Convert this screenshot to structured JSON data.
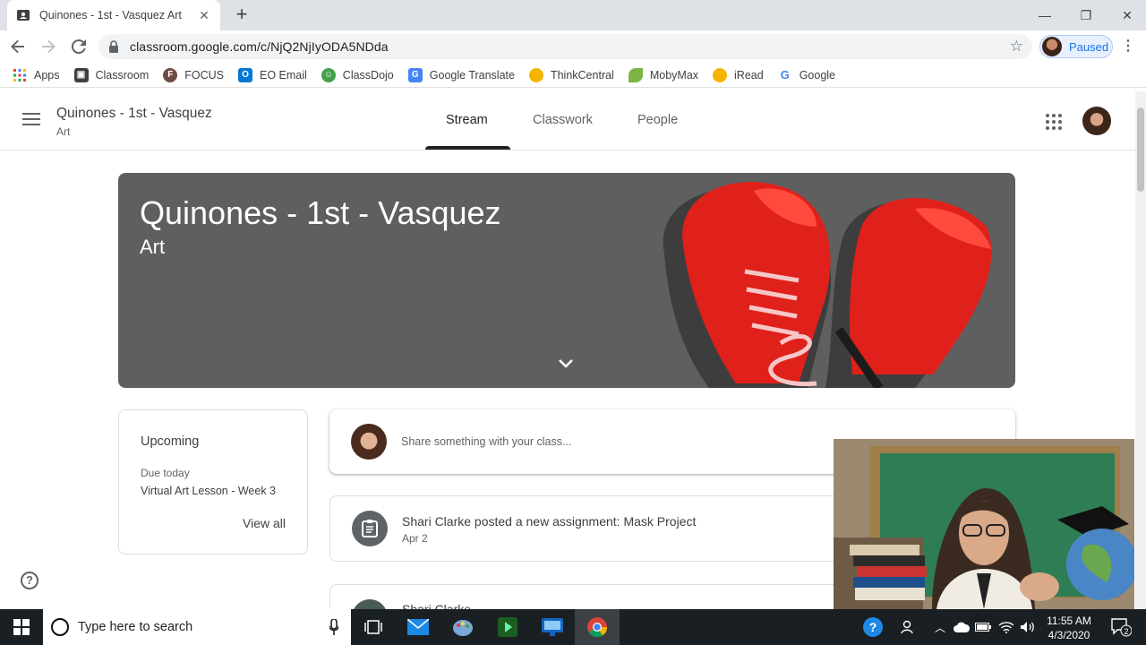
{
  "browser": {
    "tab_title": "Quinones - 1st - Vasquez Art",
    "new_tab": "+",
    "url": "classroom.google.com/c/NjQ2NjIyODA5NDda",
    "profile_status": "Paused"
  },
  "bookmarks": [
    {
      "label": "Apps",
      "icon": "apps-grid-icon",
      "color": "#4285f4"
    },
    {
      "label": "Classroom",
      "icon": "classroom-icon",
      "color": "#3c4043"
    },
    {
      "label": "FOCUS",
      "icon": "focus-icon",
      "color": "#6d4c41"
    },
    {
      "label": "EO Email",
      "icon": "outlook-icon",
      "color": "#0078d4"
    },
    {
      "label": "ClassDojo",
      "icon": "classdojo-icon",
      "color": "#43a047"
    },
    {
      "label": "Google Translate",
      "icon": "translate-icon",
      "color": "#4285f4"
    },
    {
      "label": "ThinkCentral",
      "icon": "circle-icon",
      "color": "#f4b400"
    },
    {
      "label": "MobyMax",
      "icon": "mobymax-icon",
      "color": "#7cb342"
    },
    {
      "label": "iRead",
      "icon": "circle-icon",
      "color": "#f4b400"
    },
    {
      "label": "Google",
      "icon": "google-icon",
      "color": "#ea4335"
    }
  ],
  "header": {
    "class_name": "Quinones - 1st - Vasquez",
    "section": "Art",
    "tabs": [
      {
        "label": "Stream",
        "active": true
      },
      {
        "label": "Classwork",
        "active": false
      },
      {
        "label": "People",
        "active": false
      }
    ]
  },
  "banner": {
    "title": "Quinones - 1st - Vasquez",
    "subtitle": "Art",
    "background": "#5f5f5f"
  },
  "upcoming": {
    "heading": "Upcoming",
    "due_label": "Due today",
    "item": "Virtual Art Lesson - Week 3",
    "view_all": "View all"
  },
  "share": {
    "placeholder": "Share something with your class..."
  },
  "posts": [
    {
      "title": "Shari Clarke posted a new assignment: Mask Project",
      "date": "Apr 2"
    },
    {
      "title": "Shari Clarke",
      "date": ""
    }
  ],
  "taskbar": {
    "search_placeholder": "Type here to search",
    "time": "11:55 AM",
    "date": "4/3/2020",
    "notifications": "2"
  }
}
